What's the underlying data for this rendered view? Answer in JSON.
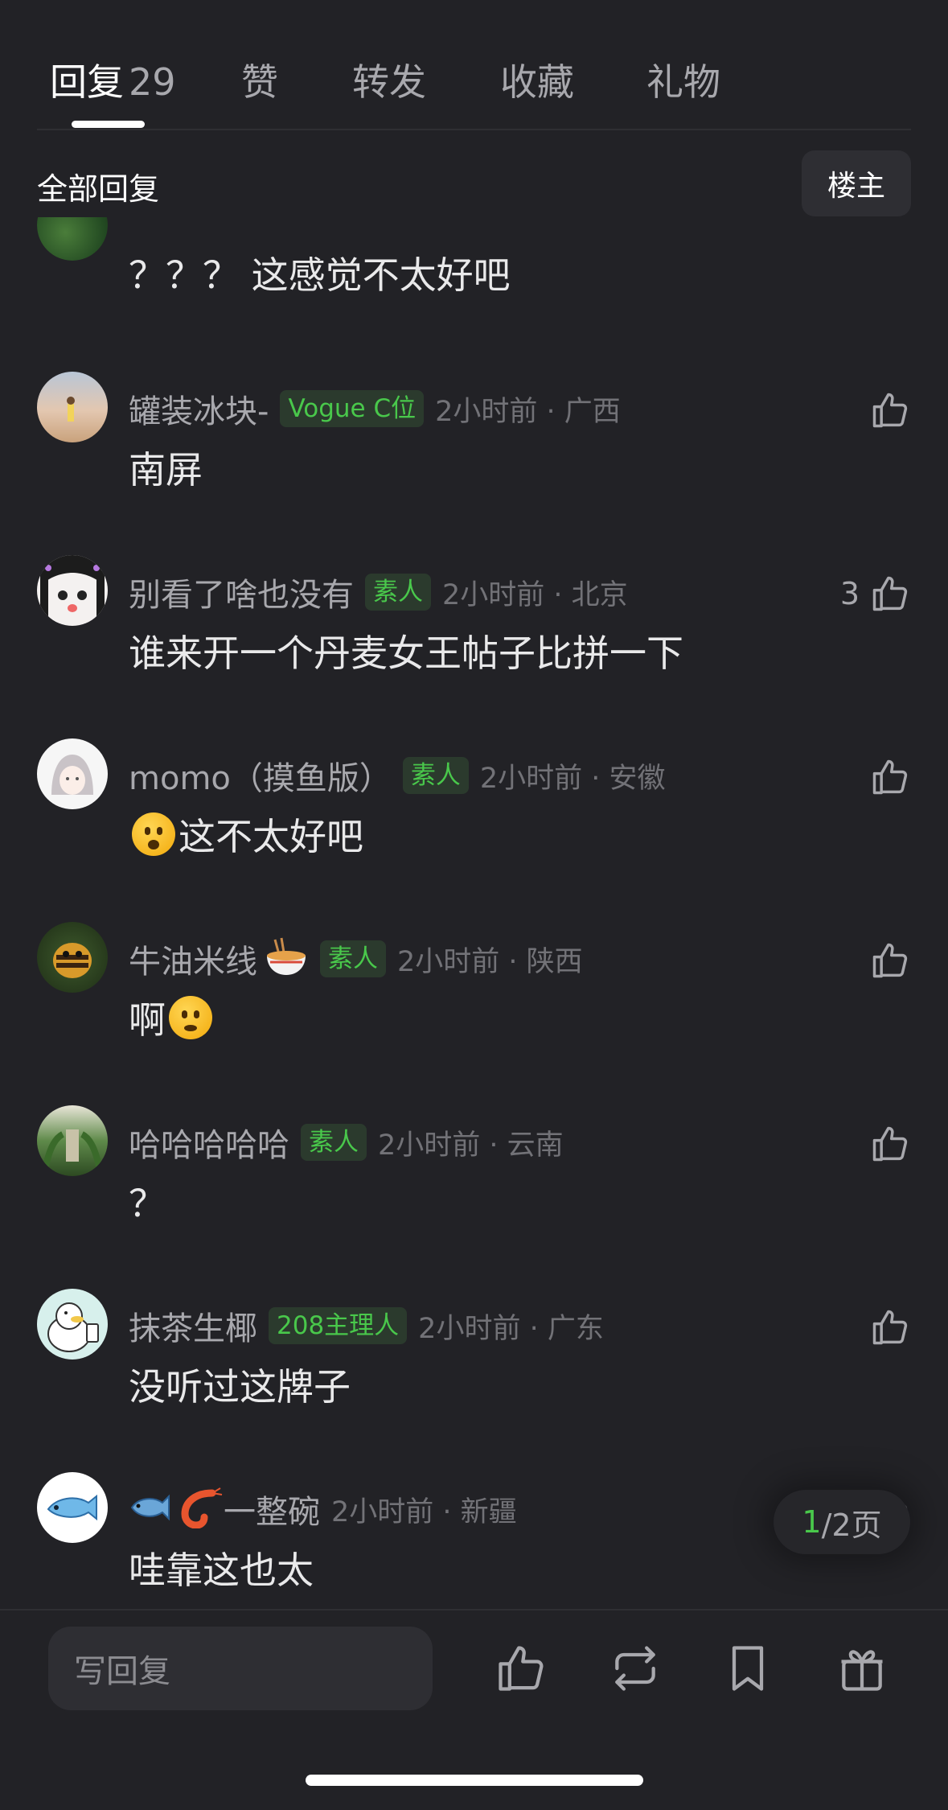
{
  "tabs": [
    {
      "label": "回复",
      "count": "29",
      "active": true
    },
    {
      "label": "赞"
    },
    {
      "label": "转发"
    },
    {
      "label": "收藏"
    },
    {
      "label": "礼物"
    }
  ],
  "filter": {
    "title": "全部回复",
    "op_button": "楼主"
  },
  "partial_comment": {
    "text": "？？？ 这感觉不太好吧"
  },
  "comments": [
    {
      "username": "罐装冰块-",
      "badge": "Vogue C位",
      "time": "2小时前 · 广西",
      "text": "南屏",
      "likes": ""
    },
    {
      "username": "别看了啥也没有",
      "badge": "素人",
      "time": "2小时前 · 北京",
      "text": "谁来开一个丹麦女王帖子比拼一下",
      "likes": "3"
    },
    {
      "username": "momo（摸鱼版）",
      "badge": "素人",
      "time": "2小时前 · 安徽",
      "text": "这不太好吧",
      "likes": ""
    },
    {
      "username": "牛油米线",
      "badge": "素人",
      "time": "2小时前 · 陕西",
      "text": "啊",
      "likes": ""
    },
    {
      "username": "哈哈哈哈哈",
      "badge": "素人",
      "time": "2小时前 · 云南",
      "text": "？",
      "likes": ""
    },
    {
      "username": "抹茶生椰",
      "badge": "208主理人",
      "time": "2小时前 · 广东",
      "text": "没听过这牌子",
      "likes": ""
    },
    {
      "username": "一整碗",
      "badge": "",
      "time": "2小时前 · 新疆",
      "text": "哇靠这也太",
      "likes": ""
    }
  ],
  "pagination": {
    "current": "1",
    "total_label": "/2页"
  },
  "bottom_bar": {
    "reply_placeholder": "写回复"
  },
  "colors": {
    "background": "#222226",
    "accent_green": "#49c84b",
    "muted_text": "#a8a8ad"
  }
}
